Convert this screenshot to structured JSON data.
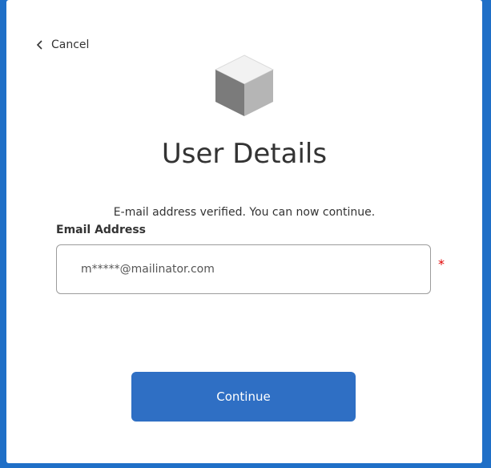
{
  "header": {
    "cancel_label": "Cancel",
    "cancel_icon": "chevron-left-icon",
    "logo_icon": "cube-icon"
  },
  "main": {
    "title": "User Details",
    "info_text": "E-mail address verified. You can now continue.",
    "email_label": "Email Address",
    "email_value": "m*****@mailinator.com",
    "required_marker": "*",
    "continue_label": "Continue"
  },
  "colors": {
    "background": "#1f6fc7",
    "button": "#2f6fc4",
    "required": "#e00000"
  }
}
